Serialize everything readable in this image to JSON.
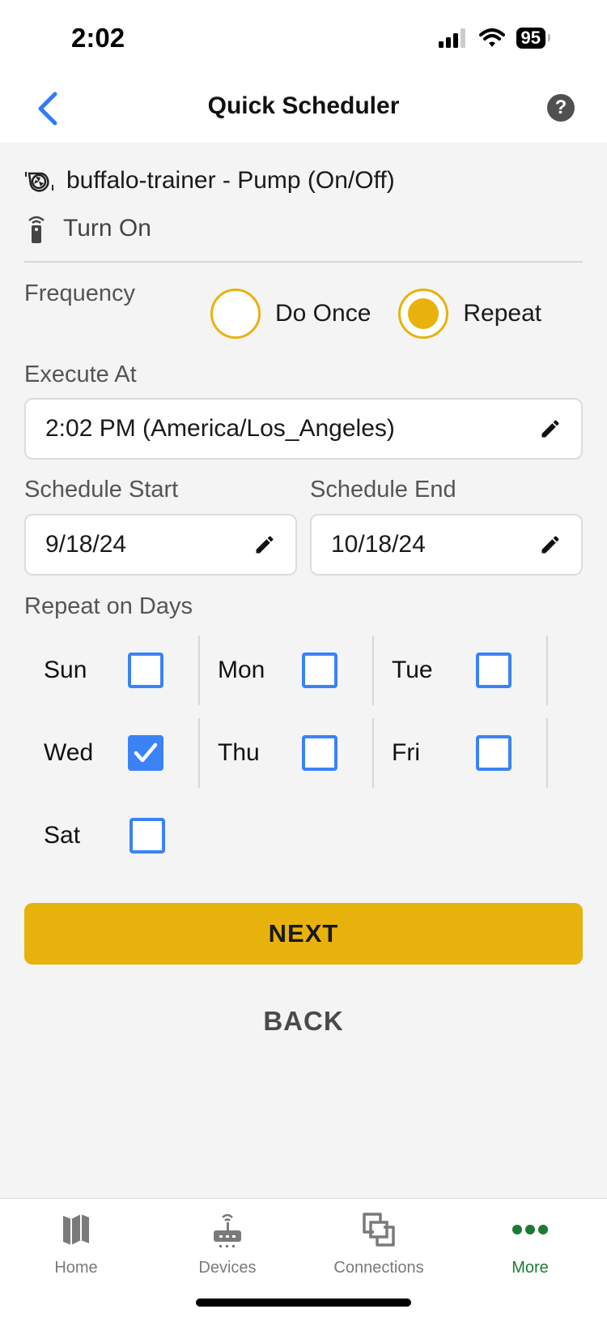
{
  "status_bar": {
    "time": "2:02",
    "battery": "95",
    "icons": [
      "signal-icon",
      "wifi-icon",
      "battery-icon"
    ]
  },
  "header": {
    "title": "Quick Scheduler",
    "back_icon": "chevron-left-icon",
    "help_icon": "help-icon",
    "help_glyph": "?"
  },
  "device": {
    "name": "buffalo-trainer - Pump (On/Off)",
    "icon": "pump-icon",
    "action": "Turn On",
    "action_icon": "remote-icon"
  },
  "frequency": {
    "label": "Frequency",
    "options": [
      {
        "label": "Do Once",
        "selected": false
      },
      {
        "label": "Repeat",
        "selected": true
      }
    ]
  },
  "execute_at": {
    "label": "Execute At",
    "value": "2:02 PM (America/Los_Angeles)"
  },
  "schedule": {
    "start_label": "Schedule Start",
    "start_value": "9/18/24",
    "end_label": "Schedule End",
    "end_value": "10/18/24"
  },
  "repeat_days": {
    "label": "Repeat on Days",
    "days": [
      {
        "label": "Sun",
        "checked": false
      },
      {
        "label": "Mon",
        "checked": false
      },
      {
        "label": "Tue",
        "checked": false
      },
      {
        "label": "Wed",
        "checked": true
      },
      {
        "label": "Thu",
        "checked": false
      },
      {
        "label": "Fri",
        "checked": false
      },
      {
        "label": "Sat",
        "checked": false
      }
    ]
  },
  "buttons": {
    "next": "NEXT",
    "back": "BACK"
  },
  "tabbar": {
    "tabs": [
      {
        "label": "Home",
        "icon": "map-icon",
        "active": false
      },
      {
        "label": "Devices",
        "icon": "router-icon",
        "active": false
      },
      {
        "label": "Connections",
        "icon": "connections-icon",
        "active": false
      },
      {
        "label": "More",
        "icon": "more-dots-icon",
        "active": true
      }
    ]
  },
  "colors": {
    "accent": "#e8b20c",
    "checkbox": "#3b82f6",
    "active_tab": "#1c7a32",
    "back_chevron": "#2f7cf6"
  }
}
